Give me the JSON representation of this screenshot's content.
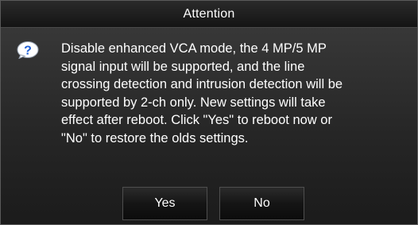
{
  "dialog": {
    "title": "Attention",
    "icon": "question-icon",
    "message": "Disable enhanced VCA mode, the 4 MP/5 MP\nsignal input will be supported, and the line\ncrossing detection and intrusion detection will be\nsupported by 2-ch only. New settings will take\neffect after reboot. Click \"Yes\" to reboot now or\n\"No\" to restore the olds settings.",
    "buttons": {
      "yes_label": "Yes",
      "no_label": "No"
    }
  },
  "colors": {
    "background": "#262626",
    "text": "#ffffff",
    "icon_blue": "#1f5fd6",
    "icon_bubble": "#ffffff"
  }
}
